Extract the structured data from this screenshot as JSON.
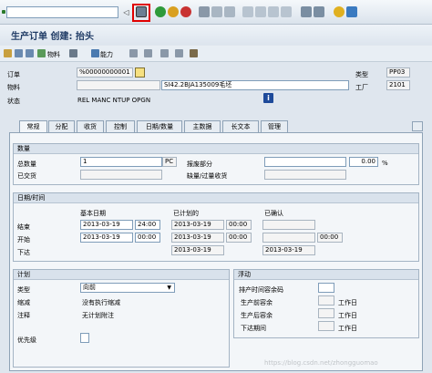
{
  "title": "生产订单 创建: 抬头",
  "appbar": {
    "material": "物料",
    "capacity": "能力"
  },
  "header": {
    "order_label": "订单",
    "order_value": "%00000000001",
    "type_label": "类型",
    "type_value": "PP03",
    "material_label": "物料",
    "material_value": "SI42.2BJA135009毛坯",
    "plant_label": "工厂",
    "plant_value": "2101",
    "status_label": "状态",
    "status_value": "REL  MANC NTUP OPGN"
  },
  "tabs": [
    "常规",
    "分配",
    "收货",
    "控制",
    "日期/数量",
    "主数据",
    "长文本",
    "管理"
  ],
  "quantity": {
    "section": "数量",
    "total_label": "总数量",
    "total_value": "1",
    "unit": "PC",
    "scrap_label": "报废部分",
    "scrap_value": "0.00",
    "percent": "%",
    "delivered_label": "已交货",
    "shortage_label": "缺量/过量收货"
  },
  "dates": {
    "section": "日期/时间",
    "col_basic": "基本日期",
    "col_scheduled": "已计划的",
    "col_confirmed": "已确认",
    "end_label": "结束",
    "start_label": "开始",
    "release_label": "下达",
    "basic_end_date": "2013-03-19",
    "basic_end_time": "24:00",
    "basic_start_date": "2013-03-19",
    "basic_start_time": "00:00",
    "sched_end_date": "2013-03-19",
    "sched_end_time": "00:00",
    "sched_start_date": "2013-03-19",
    "sched_start_time": "00:00",
    "sched_release_date": "2013-03-19",
    "conf_start_time": "00:00",
    "conf_release_date": "2013-03-19"
  },
  "planning": {
    "section": "计划",
    "type_label": "类型",
    "type_value": "向前",
    "reduction_label": "缩减",
    "reduction_value": "没有执行缩减",
    "note_label": "注释",
    "note_value": "无计划附注",
    "priority_label": "优先级"
  },
  "float": {
    "section": "浮动",
    "sched_margin_label": "排产时间容余码",
    "before_label": "生产前容余",
    "after_label": "生产后容余",
    "release_label": "下达期间",
    "workday": "工作日"
  },
  "watermark": "https://blog.csdn.net/zhongguomao"
}
